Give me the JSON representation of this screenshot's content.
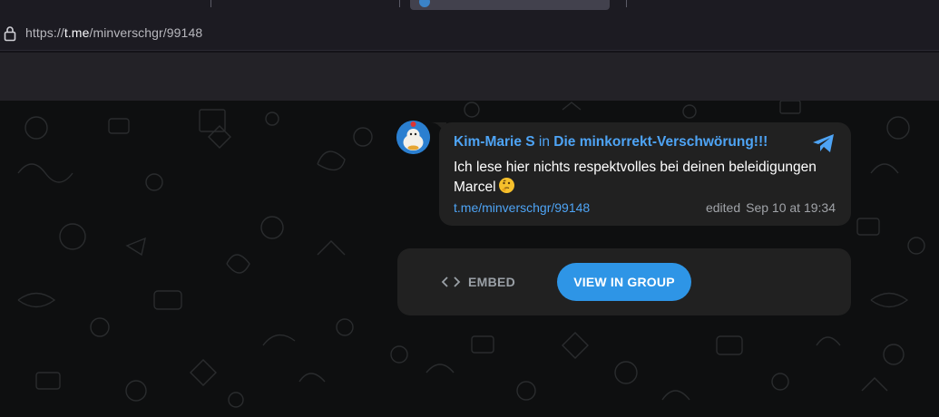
{
  "browser": {
    "url_scheme": "https://",
    "url_host": "t.me",
    "url_path": "/minverschgr/99148"
  },
  "message": {
    "author_name": "Kim-Marie S",
    "in_word": "in",
    "channel_name": "Die minkorrekt-Verschwörung!!!",
    "text": "Ich lese hier nichts respektvolles bei deinen beleidigungen Marcel",
    "emoji_name": "thinking-face",
    "link_text": "t.me/minverschgr/99148",
    "edited_label": "edited",
    "timestamp": "Sep 10 at 19:34"
  },
  "actions": {
    "embed_label": "EMBED",
    "view_label": "VIEW IN GROUP"
  },
  "colors": {
    "accent": "#2e95e6",
    "link": "#4ea4f5",
    "bubble_bg": "#212121",
    "page_bg": "#0e0f10"
  }
}
